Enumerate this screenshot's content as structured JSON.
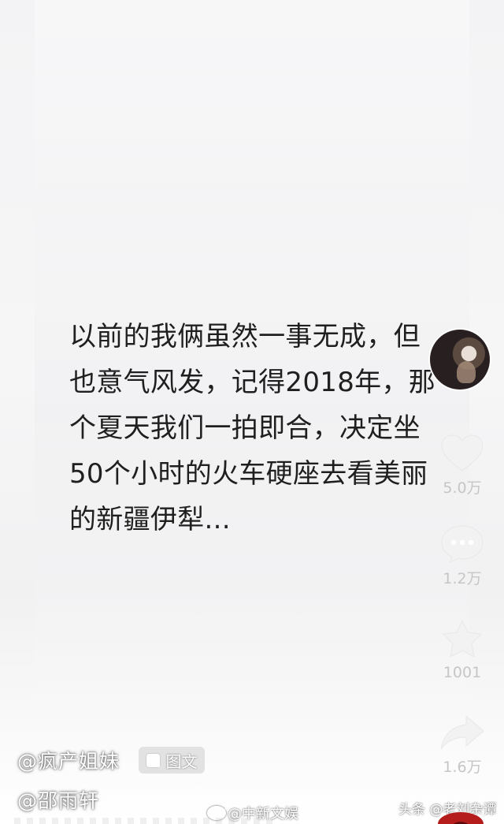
{
  "caption": {
    "lines": [
      "以前的我俩虽然一事无成，但",
      "也意气风发，记得2018年，那",
      "个夏天我们一拍即合，决定坐",
      "50个小时的火车硬座去看美丽",
      "的新疆伊犁..."
    ]
  },
  "actions": {
    "like_count": "5.0万",
    "comment_count": "1.2万",
    "favorite_count": "1001",
    "share_count": "1.6万"
  },
  "author": {
    "name": "@疯产姐妹",
    "badge_label": "图文"
  },
  "description": "@邵雨轩",
  "watermarks": {
    "weibo": "@中新文娱",
    "toutiao": "头条 @老刘杂谭"
  },
  "colors": {
    "background": "#f6f6f7",
    "caption_text": "#1f1f1f",
    "rail_icon": "#f2f2f2",
    "rail_text": "#c6c6c6",
    "badge_bg": "#e2e2e2"
  },
  "icons": {
    "avatar": "profile-avatar",
    "like": "heart-icon",
    "comment": "comment-icon",
    "favorite": "star-icon",
    "share": "share-arrow-icon",
    "badge": "image-text-icon",
    "weibo": "weibo-icon"
  }
}
